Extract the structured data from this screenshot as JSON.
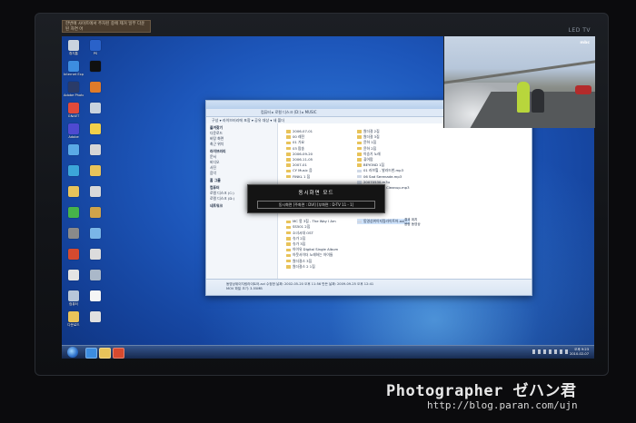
{
  "monitor": {
    "brand": "LED TV",
    "sticker_text": "한번에 사이트에서 주차된 중에 제거 일부 다운 된 자연 어"
  },
  "desktop_icons": [
    {
      "label": "휴지통",
      "color": "#c9d3de"
    },
    {
      "label": "Internet Explorer",
      "color": "#3d8de0"
    },
    {
      "label": "Adobe Photoshop",
      "color": "#2a3b68"
    },
    {
      "label": "GNAET",
      "color": "#e04a3a"
    },
    {
      "label": "Adobe",
      "color": "#4e4ad1"
    },
    {
      "label": "",
      "color": "#5aa9e6"
    },
    {
      "label": "",
      "color": "#3ca6d9"
    },
    {
      "label": "",
      "color": "#e8c35a"
    },
    {
      "label": "",
      "color": "#46b34a"
    },
    {
      "label": "",
      "color": "#8a8a8a"
    },
    {
      "label": "",
      "color": "#d64a2f"
    },
    {
      "label": "",
      "color": "#e4e4e4"
    },
    {
      "label": "컴퓨터",
      "color": "#b8c7d9"
    },
    {
      "label": "다운로드",
      "color": "#e8c35a"
    },
    {
      "label": "PS",
      "color": "#2a62c9"
    },
    {
      "label": "",
      "color": "#101010"
    },
    {
      "label": "",
      "color": "#e07b2a"
    },
    {
      "label": "",
      "color": "#c9d3de"
    },
    {
      "label": "",
      "color": "#f1d04a"
    },
    {
      "label": "",
      "color": "#d6d6d6"
    },
    {
      "label": "",
      "color": "#e8c35a"
    },
    {
      "label": "",
      "color": "#d9d9d9"
    },
    {
      "label": "",
      "color": "#cfa34a"
    },
    {
      "label": "",
      "color": "#7ab6e8"
    },
    {
      "label": "",
      "color": "#dcdcdc"
    },
    {
      "label": "",
      "color": "#aab8c9"
    },
    {
      "label": "",
      "color": "#f5f5f5"
    },
    {
      "label": "",
      "color": "#e0e0e0"
    }
  ],
  "explorer": {
    "address": "컴퓨터 ▸ 로컬 디스크 (D:) ▸ MUSIC",
    "toolbar": "구성 ▾   라이브러리에 포함 ▾   공유 대상 ▾   새 폴더",
    "nav": [
      {
        "label": "즐겨찾기",
        "head": true
      },
      {
        "label": "다운로드",
        "head": false
      },
      {
        "label": "바탕 화면",
        "head": false
      },
      {
        "label": "최근 위치",
        "head": false
      },
      {
        "label": "라이브러리",
        "head": true
      },
      {
        "label": "문서",
        "head": false
      },
      {
        "label": "비디오",
        "head": false
      },
      {
        "label": "사진",
        "head": false
      },
      {
        "label": "음악",
        "head": false
      },
      {
        "label": "홈 그룹",
        "head": true
      },
      {
        "label": "컴퓨터",
        "head": true
      },
      {
        "label": "로컬 디스크 (C:)",
        "head": false
      },
      {
        "label": "로컬 디스크 (D:)",
        "head": false
      },
      {
        "label": "네트워크",
        "head": true
      }
    ],
    "files_col1": [
      "2006-07-01",
      "00 레전",
      "01 가요",
      "03 팝송",
      "2006-09-20",
      "2006-11-05",
      "2007-01",
      "CY Music 음",
      "FINKL 1 집",
      "",
      "",
      "",
      "",
      "",
      "",
      "",
      "MC 몽 3집 - The Way I Am",
      "SS501 2집",
      "소녀시대 OST",
      "슈가 2집",
      "슈가 3집",
      "아이유 Digital Single Album",
      "아웃사이더 노래하는 아이들",
      "원더걸스 3집",
      "원더걸스 2 1집"
    ],
    "files_col2": [
      "원더걸 2집",
      "원더걸 3집",
      "윤하 1집",
      "윤하 2집",
      "이승기 노래",
      "퓨어팝",
      "BEYOND 1집",
      "01 러브힐 - 발라드한.mp3",
      "06 Sad Serenade.mp3",
      "20070530.m3u",
      "Audio Sound Cleanup.mp3",
      "",
      "",
      "",
      "",
      "",
      "동영상위이지링라이트어.avi"
    ],
    "file_side": [
      "결과 위치",
      "용량 동영상"
    ],
    "status_line1": "동영상위이지링라이트어.avi   수정한 날짜: 2002-05-20 오후 11:56   만든 날짜: 2009-09-25 오후 12:41",
    "status_line2": "MOV 파일   크기: 3.55MB"
  },
  "overlay": {
    "title": "동시화면 모드",
    "info": "동시화면 [주화면 : DVI] [부화면 : D-TV  11 - 1]"
  },
  "pip": {
    "channel_logo": "mbc"
  },
  "taskbar": {
    "apps": [
      {
        "color": "#3d8de0"
      },
      {
        "color": "#e8c35a"
      },
      {
        "color": "#d64a2f"
      }
    ],
    "time": "오후 9:23",
    "date": "2010-02-07"
  },
  "watermark": {
    "title": "Photographer ゼハン君",
    "url": "http://blog.paran.com/ujn"
  }
}
